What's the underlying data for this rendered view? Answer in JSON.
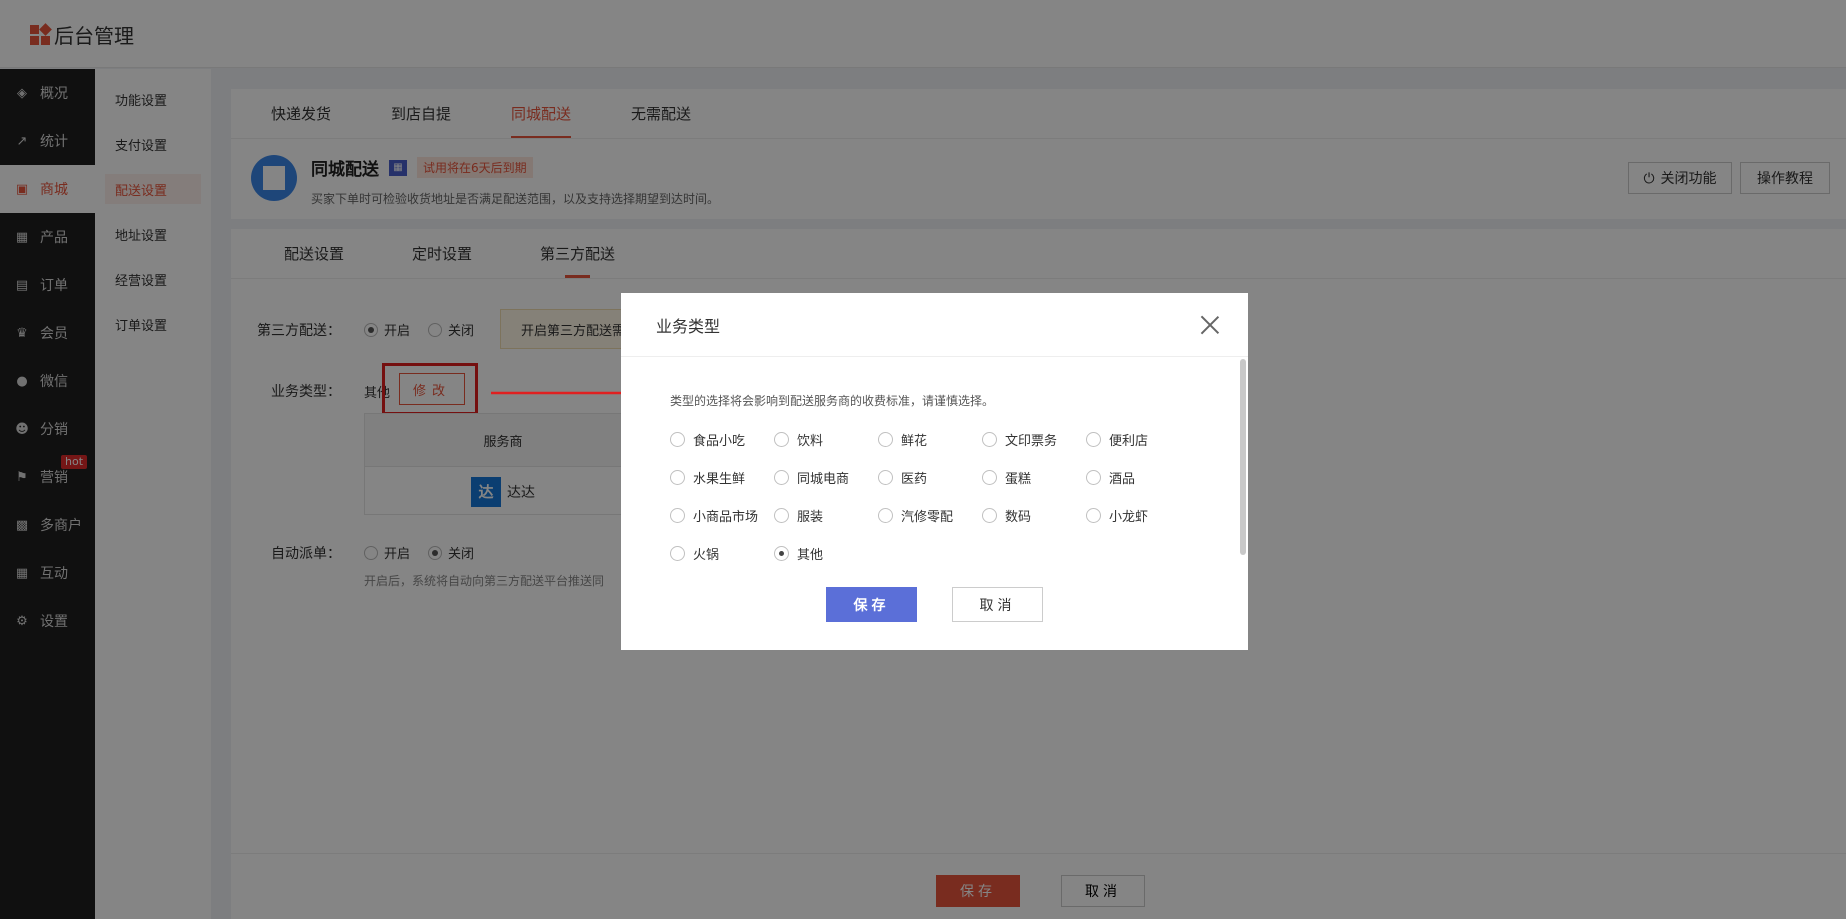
{
  "header": {
    "title": "后台管理"
  },
  "sidebar": {
    "items": [
      {
        "label": "概况",
        "icon": "layers-icon",
        "glyph": "◈"
      },
      {
        "label": "统计",
        "icon": "chart-icon",
        "glyph": "↗"
      },
      {
        "label": "商城",
        "icon": "shop-icon",
        "glyph": "▣",
        "active": true
      },
      {
        "label": "产品",
        "icon": "grid-icon",
        "glyph": "▦"
      },
      {
        "label": "订单",
        "icon": "clipboard-icon",
        "glyph": "▤"
      },
      {
        "label": "会员",
        "icon": "crown-icon",
        "glyph": "♛"
      },
      {
        "label": "微信",
        "icon": "wechat-icon",
        "glyph": "●"
      },
      {
        "label": "分销",
        "icon": "users-icon",
        "glyph": "☻"
      },
      {
        "label": "营销",
        "icon": "flag-icon",
        "glyph": "⚑",
        "badge": "hot"
      },
      {
        "label": "多商户",
        "icon": "store-icon",
        "glyph": "▩"
      },
      {
        "label": "互动",
        "icon": "apps-icon",
        "glyph": "▦"
      },
      {
        "label": "设置",
        "icon": "gear-icon",
        "glyph": "⚙"
      }
    ]
  },
  "submenu": {
    "items": [
      "功能设置",
      "支付设置",
      "配送设置",
      "地址设置",
      "经营设置",
      "订单设置"
    ],
    "active_index": 2
  },
  "top_tabs": [
    "快递发货",
    "到店自提",
    "同城配送",
    "无需配送"
  ],
  "top_tabs_active": 2,
  "feature": {
    "title": "同城配送",
    "trial": "试用将在6天后到期",
    "desc": "买家下单时可检验收货地址是否满足配送范围，以及支持选择期望到达时间。",
    "close_button": "关闭功能",
    "tutorial_button": "操作教程"
  },
  "sub_tabs": [
    "配送设置",
    "定时设置",
    "第三方配送"
  ],
  "sub_tabs_active": 2,
  "form": {
    "third_party_label": "第三方配送：",
    "opt_on": "开启",
    "opt_off": "关闭",
    "notice": "开启第三方配送需",
    "business_label": "业务类型：",
    "business_value": "其他",
    "modify_button": "修改",
    "provider_header": "服务商",
    "provider_name": "达达",
    "provider_logo": "达",
    "auto_label": "自动派单：",
    "auto_help": "开启后，系统将自动向第三方配送平台推送同"
  },
  "footer": {
    "save": "保存",
    "cancel": "取消"
  },
  "modal": {
    "title": "业务类型",
    "tip": "类型的选择将会影响到配送服务商的收费标准，请谨慎选择。",
    "rows": [
      [
        "食品小吃",
        "饮料",
        "鲜花",
        "文印票务",
        "便利店"
      ],
      [
        "水果生鲜",
        "同城电商",
        "医药",
        "蛋糕",
        "酒品"
      ],
      [
        "小商品市场",
        "服装",
        "汽修零配",
        "数码",
        "小龙虾"
      ],
      [
        "火锅",
        "其他"
      ]
    ],
    "selected": "其他",
    "save": "保存",
    "cancel": "取消"
  },
  "colors": {
    "accent": "#e9553c",
    "modal_primary": "#5b6fd8",
    "sidebar_bg": "#1f1f1f"
  }
}
